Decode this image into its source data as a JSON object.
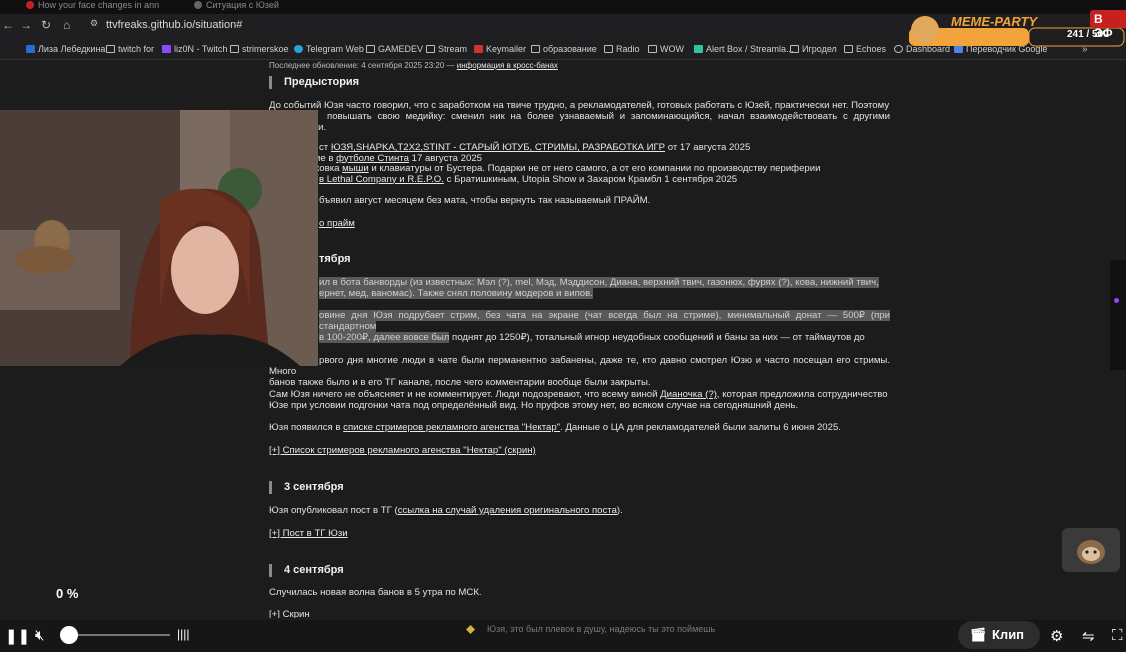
{
  "browser": {
    "tabs": [
      "How your face changes in ann",
      "Ситуация с Юзей"
    ],
    "url": "ttvfreaks.github.io/situation#",
    "bookmarks": [
      "Лиза Лебедкина",
      "twitch for",
      "liz0N - Twitch",
      "strimerskoe",
      "Telegram Web",
      "GAMEDEV",
      "Stream",
      "Keymailer",
      "образование",
      "Radio",
      "WOW",
      "Alert Box / Streamla...",
      "Игродел",
      "Echoes",
      "Dashboard",
      "Переводчик Google"
    ]
  },
  "page": {
    "updated": "Последнее обновление: 4 сентября 2025 23:20 —",
    "updated_link": "информация в кросс-банах",
    "h_prehistory": "Предыстория",
    "p1": "До событий Юзя часто говорил, что с заработком на твиче трудно, а рекламодателей, готовых работать с Юзей, практически нет. Поэтому",
    "p1b": "повышать свою медийку: сменил ник на более узнаваемый и запоминающийся, начал взаимодействовать с другими стримерами.",
    "l1a": "ст",
    "l1link": "ЮЗЯ,SHAPKA,T2X2,STINT - СТАРЫЙ ЮТУБ, СТРИМЫ, РАЗРАБОТКА ИГР",
    "l1b": "от 17 августа 2025",
    "l2a": "ие в",
    "l2link": "футболе Стинта",
    "l2b": "17 августа 2025",
    "l3a": "ковка",
    "l3link": "мыши",
    "l3b": "и клавиатуры от Бустера. Подарки не от него самого, а от его компании по производству периферии",
    "l4link": "в Lethal Company и R.E.P.O.",
    "l4b": "с Братишкиным, Utopia Show и Захаром Крамбл 1 сентября 2025",
    "p_august": "бъявил август месяцем без мата, чтобы вернуть так называемый ПРАЙМ.",
    "prime_link": "о прайм",
    "h_sept_a": "тября",
    "p_bans1": "ил в бота банворды (из известных: Мэл (?), mel, Мэд, Мэддисон, Диана, верхний твич, газонюх, фурях (?), кова, нижний твич,",
    "p_bans2": "ернет, мед, ваномас). Также снял половину модеров и випов.",
    "p_don1": "овине дня Юзя подрубает стрим, без чата на экране (чат всегда был на стриме), минимальный донат — 500₽ (при стандартном",
    "p_don2a": "в 100-200₽, далее вовсе был",
    "p_don2b": "поднят до 1250₽), тотальный игнор неудобных сообщений и баны за них — от таймаутов до",
    "p_first1": "рвого дня многие люди в чате были перманентно забанены, даже те, кто давно смотрел Юзю и часто посещал его стримы. Много",
    "p_first2": "банов также было и в его ТГ канале, после чего комментарии вообще были закрыты.",
    "p_silent1": "Сам Юзя ничего не объясняет и не комментирует. Люди подозревают, что всему виной",
    "p_silent_link": "Дианочка (?)",
    "p_silent1b": ", которая предложила сотрудничество",
    "p_silent2": "Юзе при условии подгонки чата под определённый вид. Но пруфов этому нет, во всяком случае на сегодняшний день.",
    "p_nectar_a": "Юзя появился в",
    "p_nectar_link": "списке стримеров рекламного агенства \"Нектар\"",
    "p_nectar_b": ". Данные о ЦА для рекламодателей были залиты 6 июня 2025.",
    "nectar_screen": "[+] Список стримеров рекламного агенства \"Нектар\" (скрин)",
    "h_sept3": "3 сентября",
    "p_tg_a": "Юзя опубликовал пост в ТГ (",
    "p_tg_link": "ссылка на случай удаления оригинального поста",
    "p_tg_b": ").",
    "tg_post": "[+] Пост в ТГ Юзи",
    "h_sept4": "4 сентября",
    "p_wave": "Случилась новая волна банов в 5 утра по МСК.",
    "screen_more": "[+] Скрин"
  },
  "overlay": {
    "meme_title": "MEME-PARTY",
    "meme_count": "241 / 500",
    "live": "В ЭФ",
    "percent": "0 %",
    "caption": "Юзя, это был плевок в душу, надеюсь ты это поймешь"
  },
  "player": {
    "clip_label": "Клип"
  },
  "colors": {
    "live_red": "#c62020",
    "meme_orange": "#f2a33a",
    "accent_purple": "#8a4bff"
  }
}
